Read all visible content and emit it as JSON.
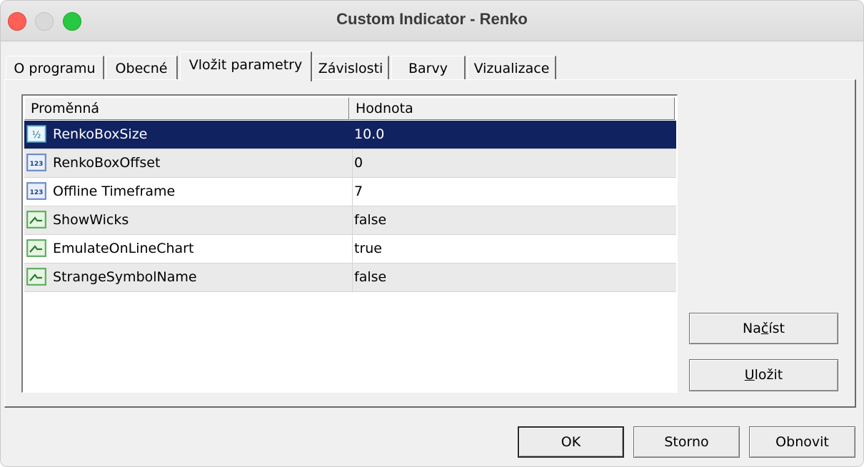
{
  "window": {
    "title": "Custom Indicator - Renko"
  },
  "tabs": [
    {
      "label": "O programu"
    },
    {
      "label": "Obecné"
    },
    {
      "label": "Vložit parametry"
    },
    {
      "label": "Závislosti"
    },
    {
      "label": "Barvy"
    },
    {
      "label": "Vizualizace"
    }
  ],
  "active_tab": "Vložit parametry",
  "table": {
    "headers": [
      "Proměnná",
      "Hodnota"
    ],
    "rows": [
      {
        "icon": "double-icon",
        "name": "RenkoBoxSize",
        "value": "10.0",
        "selected": true
      },
      {
        "icon": "integer-icon",
        "name": "RenkoBoxOffset",
        "value": "0"
      },
      {
        "icon": "integer-icon",
        "name": "Offline Timeframe",
        "value": "7"
      },
      {
        "icon": "boolean-icon",
        "name": "ShowWicks",
        "value": "false"
      },
      {
        "icon": "boolean-icon",
        "name": "EmulateOnLineChart",
        "value": "true"
      },
      {
        "icon": "boolean-icon",
        "name": "StrangeSymbolName",
        "value": "false"
      }
    ]
  },
  "side_buttons": {
    "load_prefix": "Na",
    "load_underlined": "č",
    "load_suffix": "íst",
    "save_prefix": "",
    "save_underlined": "U",
    "save_suffix": "ložit"
  },
  "footer_buttons": {
    "ok": "OK",
    "cancel": "Storno",
    "reset": "Obnovit"
  },
  "icon_text": {
    "double": "½",
    "integer": "123"
  },
  "colors": {
    "selection": "#112260",
    "double_icon": "#5fb4d8",
    "integer_icon": "#6a8fd0",
    "boolean_icon": "#58b85c"
  }
}
